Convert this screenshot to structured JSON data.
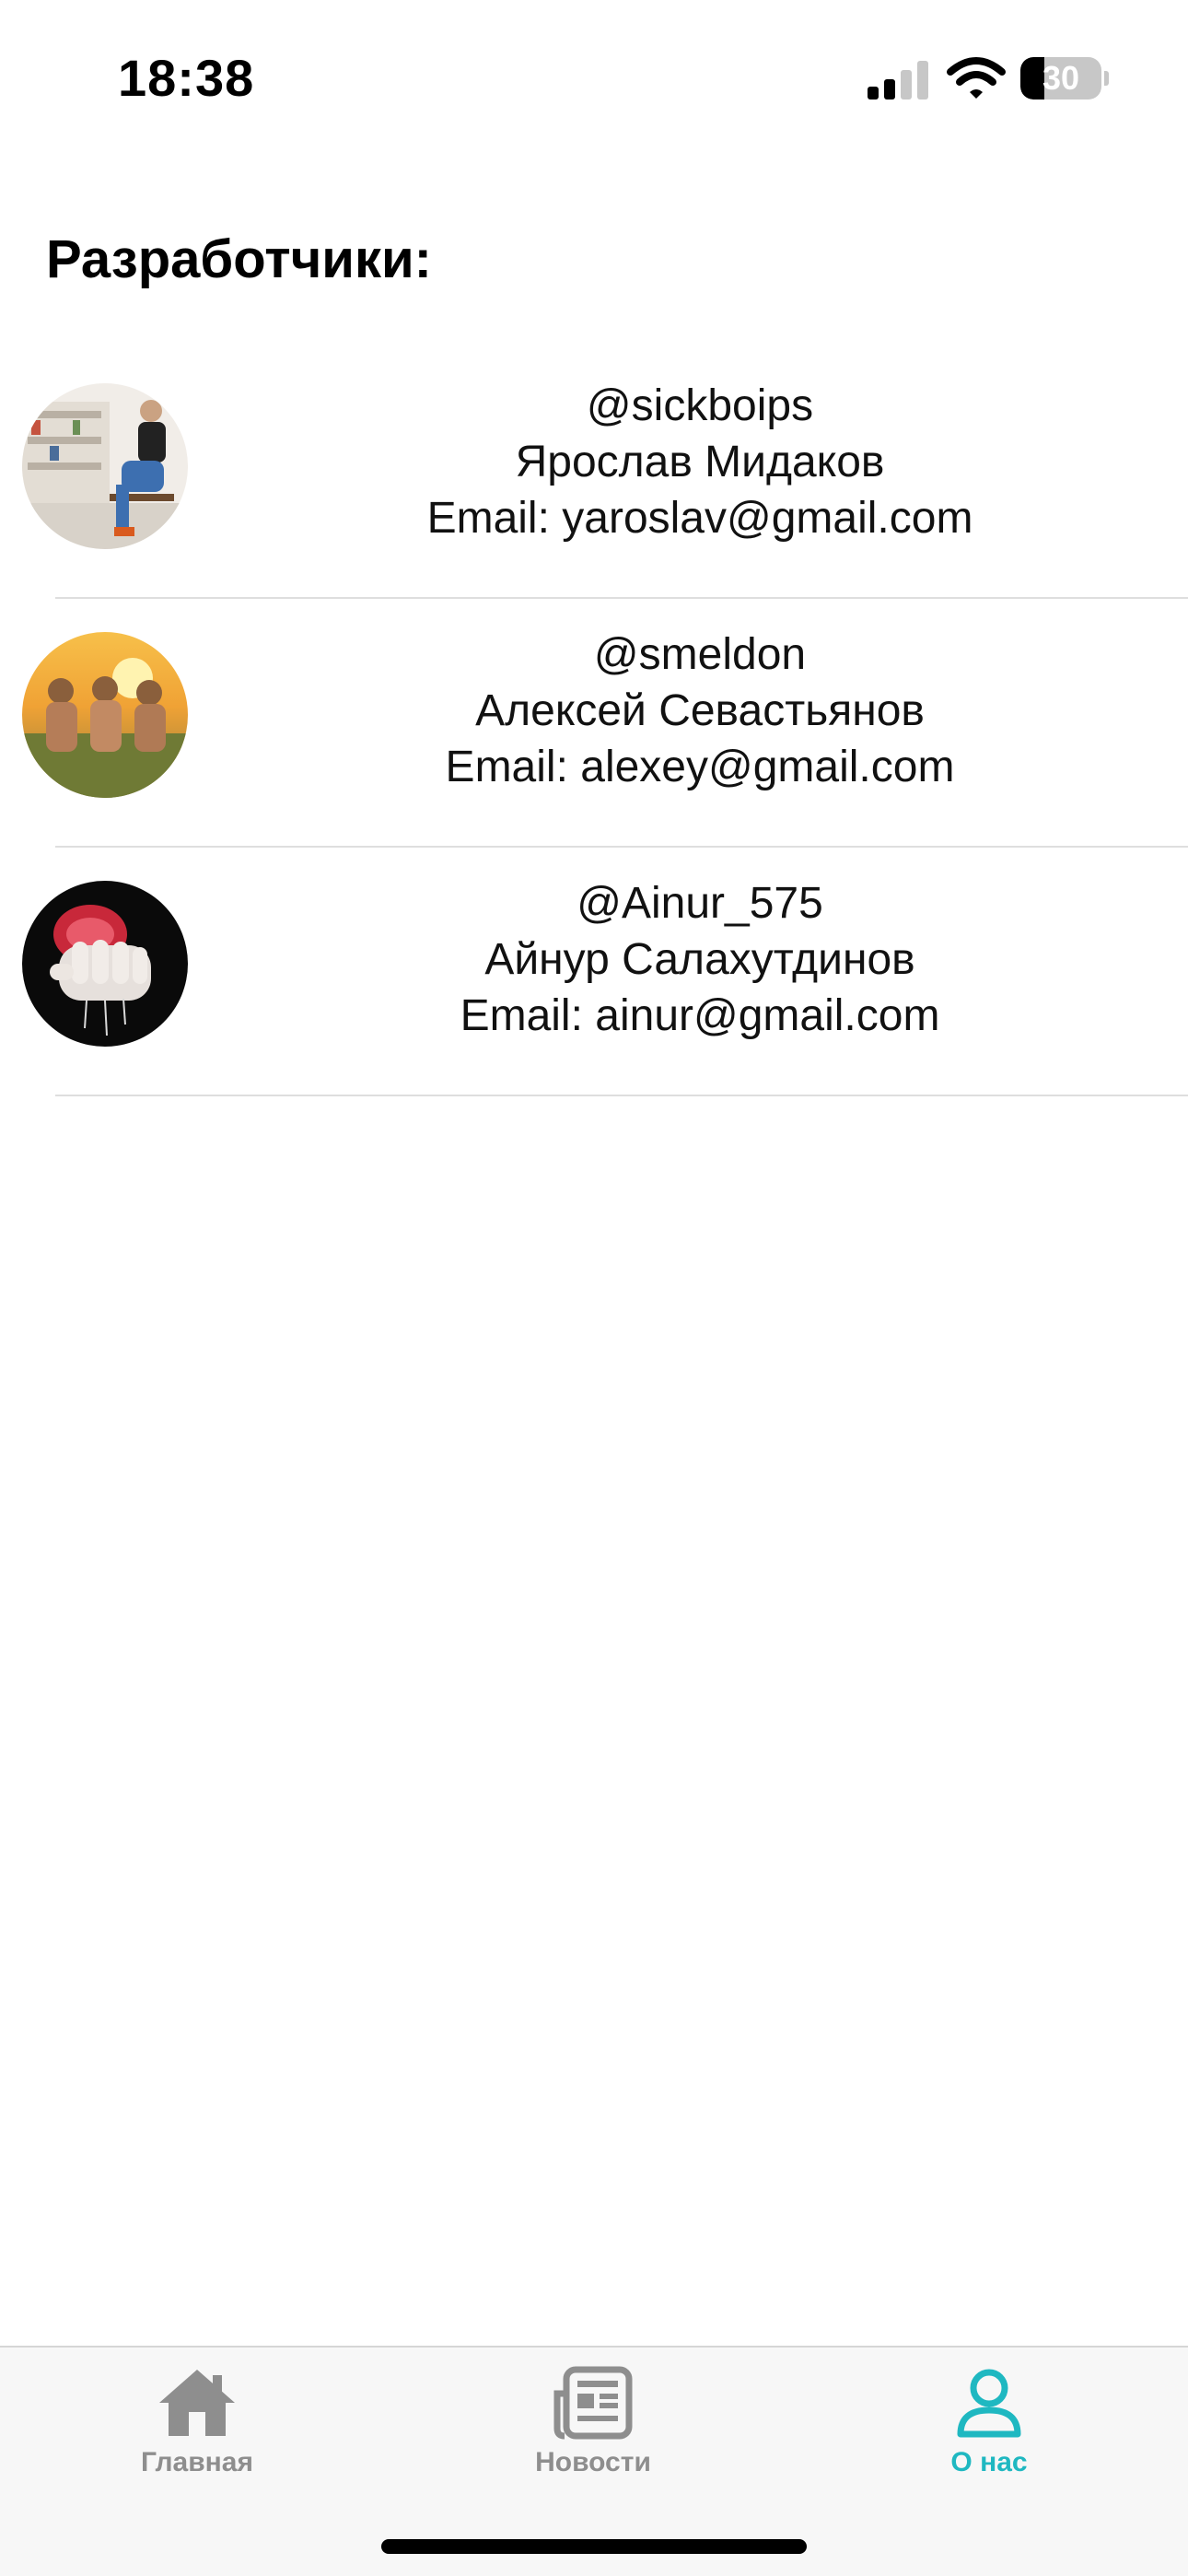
{
  "status_bar": {
    "time": "18:38",
    "battery_level": "30",
    "icons": [
      "signal-icon",
      "wifi-icon",
      "battery-icon"
    ]
  },
  "page": {
    "title": "Разработчики:"
  },
  "developers": [
    {
      "handle": "@sickboips",
      "name": "Ярослав Мидаков",
      "email": "Email: yaroslav@gmail.com",
      "avatar": "photo of man sitting on a stool"
    },
    {
      "handle": "@smeldon",
      "name": "Алексей Севастьянов",
      "email": "Email: alexey@gmail.com",
      "avatar": "photo of three people at sunset"
    },
    {
      "handle": "@Ainur_575",
      "name": "Айнур Салахутдинов",
      "email": "Email: ainur@gmail.com",
      "avatar": "photo of hand squeezing a red fruit"
    }
  ],
  "tab_bar": {
    "tabs": [
      {
        "label": "Главная",
        "icon": "house-icon",
        "active": false
      },
      {
        "label": "Новости",
        "icon": "newspaper-icon",
        "active": false
      },
      {
        "label": "О нас",
        "icon": "person-icon",
        "active": true
      }
    ],
    "accent_color": "#1fb8c1",
    "inactive_color": "#8e8e8e"
  }
}
